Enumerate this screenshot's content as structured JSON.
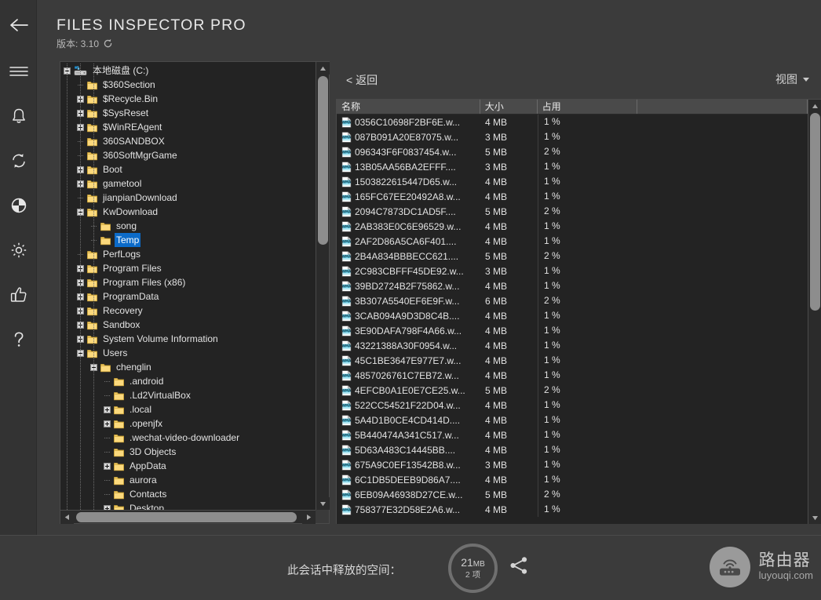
{
  "app": {
    "title": "FILES INSPECTOR PRO",
    "version_label": "版本: 3.10",
    "refresh_icon": "refresh-icon"
  },
  "rail": {
    "items": [
      {
        "name": "back-arrow-icon",
        "glyph": "back"
      },
      {
        "name": "menu-icon",
        "glyph": "hamburger"
      },
      {
        "name": "notifications-bell-icon",
        "glyph": "bell"
      },
      {
        "name": "sync-refresh-icon",
        "glyph": "sync"
      },
      {
        "name": "disk-usage-icon",
        "glyph": "pie"
      },
      {
        "name": "settings-gear-icon",
        "glyph": "gear"
      },
      {
        "name": "thumbs-up-icon",
        "glyph": "thumb"
      },
      {
        "name": "help-icon",
        "glyph": "question"
      }
    ]
  },
  "tree": {
    "nodes": [
      {
        "label": "本地磁盘 (C:)",
        "depth": 0,
        "state": "minus",
        "icon": "drive",
        "selected": false
      },
      {
        "label": "$360Section",
        "depth": 1,
        "state": "none",
        "icon": "folder",
        "selected": false
      },
      {
        "label": "$Recycle.Bin",
        "depth": 1,
        "state": "plus",
        "icon": "folder",
        "selected": false
      },
      {
        "label": "$SysReset",
        "depth": 1,
        "state": "plus",
        "icon": "folder",
        "selected": false
      },
      {
        "label": "$WinREAgent",
        "depth": 1,
        "state": "plus",
        "icon": "folder",
        "selected": false
      },
      {
        "label": "360SANDBOX",
        "depth": 1,
        "state": "none",
        "icon": "folder",
        "selected": false
      },
      {
        "label": "360SoftMgrGame",
        "depth": 1,
        "state": "none",
        "icon": "folder",
        "selected": false
      },
      {
        "label": "Boot",
        "depth": 1,
        "state": "plus",
        "icon": "folder",
        "selected": false
      },
      {
        "label": "gametool",
        "depth": 1,
        "state": "plus",
        "icon": "folder",
        "selected": false
      },
      {
        "label": "jianpianDownload",
        "depth": 1,
        "state": "none",
        "icon": "folder",
        "selected": false
      },
      {
        "label": "KwDownload",
        "depth": 1,
        "state": "minus",
        "icon": "folder",
        "selected": false
      },
      {
        "label": "song",
        "depth": 2,
        "state": "none",
        "icon": "folder",
        "selected": false
      },
      {
        "label": "Temp",
        "depth": 2,
        "state": "none",
        "icon": "folder",
        "selected": true
      },
      {
        "label": "PerfLogs",
        "depth": 1,
        "state": "none",
        "icon": "folder",
        "selected": false
      },
      {
        "label": "Program Files",
        "depth": 1,
        "state": "plus",
        "icon": "folder",
        "selected": false
      },
      {
        "label": "Program Files (x86)",
        "depth": 1,
        "state": "plus",
        "icon": "folder",
        "selected": false
      },
      {
        "label": "ProgramData",
        "depth": 1,
        "state": "plus",
        "icon": "folder",
        "selected": false
      },
      {
        "label": "Recovery",
        "depth": 1,
        "state": "plus",
        "icon": "folder",
        "selected": false
      },
      {
        "label": "Sandbox",
        "depth": 1,
        "state": "plus",
        "icon": "folder",
        "selected": false
      },
      {
        "label": "System Volume Information",
        "depth": 1,
        "state": "plus",
        "icon": "folder",
        "selected": false
      },
      {
        "label": "Users",
        "depth": 1,
        "state": "minus",
        "icon": "folder",
        "selected": false
      },
      {
        "label": "chenglin",
        "depth": 2,
        "state": "minus",
        "icon": "folder",
        "selected": false
      },
      {
        "label": ".android",
        "depth": 3,
        "state": "none",
        "icon": "folder",
        "selected": false
      },
      {
        "label": ".Ld2VirtualBox",
        "depth": 3,
        "state": "none",
        "icon": "folder",
        "selected": false
      },
      {
        "label": ".local",
        "depth": 3,
        "state": "plus",
        "icon": "folder",
        "selected": false
      },
      {
        "label": ".openjfx",
        "depth": 3,
        "state": "plus",
        "icon": "folder",
        "selected": false
      },
      {
        "label": ".wechat-video-downloader",
        "depth": 3,
        "state": "none",
        "icon": "folder",
        "selected": false
      },
      {
        "label": "3D Objects",
        "depth": 3,
        "state": "none",
        "icon": "folder",
        "selected": false
      },
      {
        "label": "AppData",
        "depth": 3,
        "state": "plus",
        "icon": "folder",
        "selected": false
      },
      {
        "label": "aurora",
        "depth": 3,
        "state": "none",
        "icon": "folder",
        "selected": false
      },
      {
        "label": "Contacts",
        "depth": 3,
        "state": "none",
        "icon": "folder",
        "selected": false
      },
      {
        "label": "Desktop",
        "depth": 3,
        "state": "plus",
        "icon": "folder",
        "selected": false
      }
    ]
  },
  "list": {
    "back_label": "< 返回",
    "view_label": "视图",
    "columns": [
      "名称",
      "大小",
      "占用",
      ""
    ],
    "rows": [
      {
        "name": "0356C10698F2BF6E.w...",
        "size": "4 MB",
        "usage": "1 %"
      },
      {
        "name": "087B091A20E87075.w...",
        "size": "3 MB",
        "usage": "1 %"
      },
      {
        "name": "096343F6F0837454.w...",
        "size": "5 MB",
        "usage": "2 %"
      },
      {
        "name": "13B05AA56BA2EFFF....",
        "size": "3 MB",
        "usage": "1 %"
      },
      {
        "name": "1503822615447D65.w...",
        "size": "4 MB",
        "usage": "1 %"
      },
      {
        "name": "165FC67EE20492A8.w...",
        "size": "4 MB",
        "usage": "1 %"
      },
      {
        "name": "2094C7873DC1AD5F....",
        "size": "5 MB",
        "usage": "2 %"
      },
      {
        "name": "2AB383E0C6E96529.w...",
        "size": "4 MB",
        "usage": "1 %"
      },
      {
        "name": "2AF2D86A5CA6F401....",
        "size": "4 MB",
        "usage": "1 %"
      },
      {
        "name": "2B4A834BBBECC621....",
        "size": "5 MB",
        "usage": "2 %"
      },
      {
        "name": "2C983CBFFF45DE92.w...",
        "size": "3 MB",
        "usage": "1 %"
      },
      {
        "name": "39BD2724B2F75862.w...",
        "size": "4 MB",
        "usage": "1 %"
      },
      {
        "name": "3B307A5540EF6E9F.w...",
        "size": "6 MB",
        "usage": "2 %"
      },
      {
        "name": "3CAB094A9D3D8C4B....",
        "size": "4 MB",
        "usage": "1 %"
      },
      {
        "name": "3E90DAFA798F4A66.w...",
        "size": "4 MB",
        "usage": "1 %"
      },
      {
        "name": "43221388A30F0954.w...",
        "size": "4 MB",
        "usage": "1 %"
      },
      {
        "name": "45C1BE3647E977E7.w...",
        "size": "4 MB",
        "usage": "1 %"
      },
      {
        "name": "4857026761C7EB72.w...",
        "size": "4 MB",
        "usage": "1 %"
      },
      {
        "name": "4EFCB0A1E0E7CE25.w...",
        "size": "5 MB",
        "usage": "2 %"
      },
      {
        "name": "522CC54521F22D04.w...",
        "size": "4 MB",
        "usage": "1 %"
      },
      {
        "name": "5A4D1B0CE4CD414D....",
        "size": "4 MB",
        "usage": "1 %"
      },
      {
        "name": "5B440474A341C517.w...",
        "size": "4 MB",
        "usage": "1 %"
      },
      {
        "name": "5D63A483C14445BB....",
        "size": "4 MB",
        "usage": "1 %"
      },
      {
        "name": "675A9C0EF13542B8.w...",
        "size": "3 MB",
        "usage": "1 %"
      },
      {
        "name": "6C1DB5DEEB9D86A7....",
        "size": "4 MB",
        "usage": "1 %"
      },
      {
        "name": "6EB09A46938D27CE.w...",
        "size": "5 MB",
        "usage": "2 %"
      },
      {
        "name": "758377E32D58E2A6.w...",
        "size": "4 MB",
        "usage": "1 %"
      }
    ],
    "file_icon": "wma-file-icon"
  },
  "bottom": {
    "freed_label": "此会话中释放的空间：",
    "freed_amount": "21",
    "freed_unit": "MB",
    "freed_items": "2 项",
    "share_icon": "share-icon"
  },
  "brand": {
    "cn": "路由器",
    "en": "luyouqi.com",
    "logo_icon": "router-icon"
  },
  "colors": {
    "accent_selection": "#0c6bc9",
    "window_bg": "#3b3b3b",
    "panel_bg": "#232323",
    "rail_bg": "#333333",
    "header_row_bg": "#4a4a4a",
    "folder": "#f2cb5c"
  }
}
